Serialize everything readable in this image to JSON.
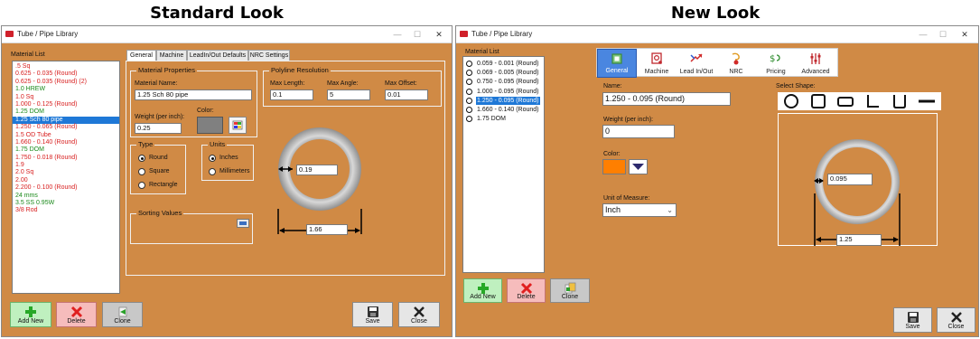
{
  "headings": {
    "left": "Standard Look",
    "right": "New Look"
  },
  "colors": {
    "window_bg": "#d08a45",
    "selection": "#1e78d7",
    "item_red": "#d82020",
    "item_green": "#1b8a1b",
    "accent_orange": "#ff7f00",
    "tab_active": "#4a86e0"
  },
  "standard": {
    "window_title": "Tube / Pipe Library",
    "controls": {
      "minimize": "—",
      "maximize": "☐",
      "close": "✕"
    },
    "material_list": {
      "label": "Material List",
      "items": [
        {
          "text": ".5 Sq",
          "color": "red"
        },
        {
          "text": "0.625 - 0.035 (Round)",
          "color": "red"
        },
        {
          "text": "0.625 - 0.035 (Round) (2)",
          "color": "red"
        },
        {
          "text": "1.0 HREW",
          "color": "green"
        },
        {
          "text": "1.0 Sq",
          "color": "red"
        },
        {
          "text": "1.000 - 0.125 (Round)",
          "color": "red"
        },
        {
          "text": "1.25 DOM",
          "color": "green"
        },
        {
          "text": "1.25 Sch 80 pipe",
          "color": "sel"
        },
        {
          "text": "1.250 - 0.065 (Round)",
          "color": "red"
        },
        {
          "text": "1.5 OD Tube",
          "color": "red"
        },
        {
          "text": "1.660 - 0.140 (Round)",
          "color": "red"
        },
        {
          "text": "1.75 DOM",
          "color": "green"
        },
        {
          "text": "1.750 - 0.018 (Round)",
          "color": "red"
        },
        {
          "text": "1.9",
          "color": "red"
        },
        {
          "text": "2.0 Sq",
          "color": "red"
        },
        {
          "text": "2.00",
          "color": "red"
        },
        {
          "text": "2.200 - 0.100 (Round)",
          "color": "red"
        },
        {
          "text": "24 mms",
          "color": "green"
        },
        {
          "text": "3.5 SS 0.95W",
          "color": "green"
        },
        {
          "text": "3/8 Rod",
          "color": "red"
        }
      ]
    },
    "tabs": [
      {
        "label": "General",
        "active": true
      },
      {
        "label": "Machine",
        "active": false
      },
      {
        "label": "LeadIn/Out Defaults",
        "active": false
      },
      {
        "label": "NRC Settings",
        "active": false
      }
    ],
    "material_properties": {
      "label": "Material Properties",
      "name_label": "Material Name:",
      "name_value": "1.25 Sch 80 pipe",
      "weight_label": "Weight (per inch):",
      "weight_value": "0.25",
      "color_label": "Color:"
    },
    "polyline": {
      "label": "Polyline Resolution",
      "max_length_label": "Max Length:",
      "max_length_value": "0.1",
      "max_angle_label": "Max Angle:",
      "max_angle_value": "5",
      "max_offset_label": "Max Offset:",
      "max_offset_value": "0.01"
    },
    "type": {
      "label": "Type",
      "options": [
        "Round",
        "Square",
        "Rectangle"
      ],
      "selected": 0
    },
    "units": {
      "label": "Units",
      "options": [
        "Inches",
        "Millimeters"
      ],
      "selected": 0
    },
    "sorting": {
      "label": "Sorting Values"
    },
    "diagram": {
      "wall": "0.19",
      "diameter": "1.66"
    },
    "buttons": {
      "add": "Add New",
      "delete": "Delete",
      "clone": "Clone",
      "save": "Save",
      "close": "Close"
    }
  },
  "newlook": {
    "window_title": "Tube / Pipe Library",
    "controls": {
      "minimize": "—",
      "maximize": "☐",
      "close": "✕"
    },
    "material_list": {
      "label": "Material List",
      "items": [
        {
          "text": "0.059 - 0.001 (Round)",
          "selected": false
        },
        {
          "text": "0.069 - 0.005 (Round)",
          "selected": false
        },
        {
          "text": "0.750 - 0.095 (Round)",
          "selected": false
        },
        {
          "text": "1.000 - 0.095 (Round)",
          "selected": false
        },
        {
          "text": "1.250 - 0.095 (Round)",
          "selected": true
        },
        {
          "text": "1.660 - 0.140 (Round)",
          "selected": false
        },
        {
          "text": "1.75 DOM",
          "selected": false
        }
      ]
    },
    "tabs": [
      {
        "label": "General",
        "icon": "general-icon",
        "active": true
      },
      {
        "label": "Machine",
        "icon": "machine-icon",
        "active": false
      },
      {
        "label": "Lead In/Out",
        "icon": "lead-in-out-icon",
        "active": false
      },
      {
        "label": "NRC",
        "icon": "nrc-icon",
        "active": false
      },
      {
        "label": "Pricing",
        "icon": "pricing-icon",
        "active": false
      },
      {
        "label": "Advanced",
        "icon": "advanced-icon",
        "active": false
      }
    ],
    "name_label": "Name:",
    "name_value": "1.250 - 0.095 (Round)",
    "weight_label": "Weight (per inch):",
    "weight_value": "0",
    "color_label": "Color:",
    "unit_label": "Unit of Measure:",
    "unit_value": "Inch",
    "select_shape_label": "Select Shape:",
    "shapes": [
      "circle",
      "square",
      "rectangle",
      "angle",
      "channel",
      "flat"
    ],
    "diagram": {
      "wall": "0.095",
      "diameter": "1.25"
    },
    "buttons": {
      "add": "Add New",
      "delete": "Delete",
      "clone": "Clone",
      "save": "Save",
      "close": "Close"
    }
  }
}
